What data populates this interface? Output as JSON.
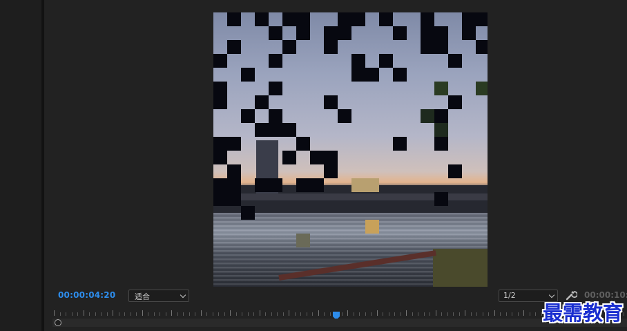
{
  "monitor": {
    "current_timecode": "00:00:04:20",
    "fit_select": {
      "selected": "适合"
    },
    "resolution_select": {
      "selected": "1/2"
    },
    "duration_timecode": "00:00:10:",
    "wrench_icon": "wrench-icon"
  },
  "video_frame": {
    "content": "sunset river scene with bridge and tower, pixelated block-dissolve transition",
    "colors": {
      "block": "#070810",
      "sky_top": "#7f8aa7",
      "sunset": "#e3b48d"
    }
  },
  "timeline": {
    "playhead_icon": "playhead-marker-icon",
    "accent_color": "#2d8ceb"
  },
  "watermark": {
    "text": "最需教育",
    "color": "#1a2fd0"
  }
}
